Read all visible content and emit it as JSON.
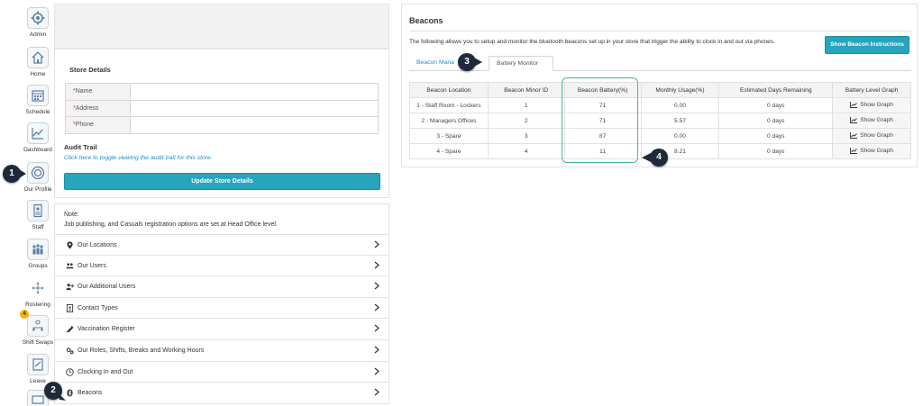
{
  "nav": {
    "items": [
      {
        "label": "Admin",
        "icon": "gear-icon"
      },
      {
        "label": "Home",
        "icon": "home-icon"
      },
      {
        "label": "Schedule",
        "icon": "schedule-icon"
      },
      {
        "label": "Dashboard",
        "icon": "chart-icon"
      },
      {
        "label": "Our Profile",
        "icon": "profile-icon"
      },
      {
        "label": "Staff",
        "icon": "staff-icon"
      },
      {
        "label": "Groups",
        "icon": "groups-icon"
      },
      {
        "label": "Rostering",
        "icon": "rostering-icon"
      },
      {
        "label": "Shift Swaps",
        "icon": "swap-icon"
      },
      {
        "label": "Leave",
        "icon": "leave-icon"
      },
      {
        "label": "",
        "icon": "chat-icon"
      }
    ],
    "shift_swaps_badge": "4"
  },
  "callouts": [
    "1",
    "2",
    "3",
    "4"
  ],
  "store": {
    "section_title": "Store Details",
    "fields": [
      {
        "label": "Name",
        "value": ""
      },
      {
        "label": "Address",
        "value": ""
      },
      {
        "label": "Phone",
        "value": ""
      }
    ],
    "audit_title": "Audit Trail",
    "audit_link": "Click here to toggle viewing the audit trail for this store.",
    "update_button": "Update Store Details"
  },
  "note": {
    "title": "Note:",
    "text": "Job publishing, and Casuals registration options are set at Head Office level."
  },
  "menu": [
    {
      "label": "Our Locations",
      "icon": "map-marker-icon"
    },
    {
      "label": "Our Users",
      "icon": "users-icon"
    },
    {
      "label": "Our Additional Users",
      "icon": "user-plus-icon"
    },
    {
      "label": "Contact Types",
      "icon": "contact-card-icon"
    },
    {
      "label": "Vaccination Register",
      "icon": "syringe-icon"
    },
    {
      "label": "Our Roles, Shifts, Breaks and Working Hours",
      "icon": "cogs-icon"
    },
    {
      "label": "Clocking In and Out",
      "icon": "clock-icon"
    },
    {
      "label": "Beacons",
      "icon": "bluetooth-icon"
    }
  ],
  "beacons": {
    "title": "Beacons",
    "description": "The following allows you to setup and monitor the bluetooth beacons set up in your store that trigger the ability to clock in and out via phones.",
    "instructions_button": "Show Beacon Instructions",
    "tabs": [
      "Beacon Mana",
      "Battery Monitor"
    ],
    "columns": [
      "Beacon Location",
      "Beacon Minor ID",
      "Beacon Battery(%)",
      "Monthly Usage(%)",
      "Estimated Days Remaining",
      "Battery Level Graph"
    ],
    "rows": [
      {
        "location": "1 - Staff Room - Lockers",
        "minor_id": "1",
        "battery": "71",
        "usage": "0.00",
        "days": "0 days",
        "graph": "Show Graph"
      },
      {
        "location": "2 - Managers Offices",
        "minor_id": "2",
        "battery": "71",
        "usage": "5.57",
        "days": "0 days",
        "graph": "Show Graph"
      },
      {
        "location": "3 - Spare",
        "minor_id": "3",
        "battery": "87",
        "usage": "0.00",
        "days": "0 days",
        "graph": "Show Graph"
      },
      {
        "location": "4 - Spare",
        "minor_id": "4",
        "battery": "11",
        "usage": "8.21",
        "days": "0 days",
        "graph": "Show Graph"
      }
    ]
  },
  "colors": {
    "accent": "#26a5bd",
    "link": "#1f8ad1",
    "highlight": "#3dbc9a",
    "callout": "#1e2a3a",
    "badge": "#f5b400"
  }
}
